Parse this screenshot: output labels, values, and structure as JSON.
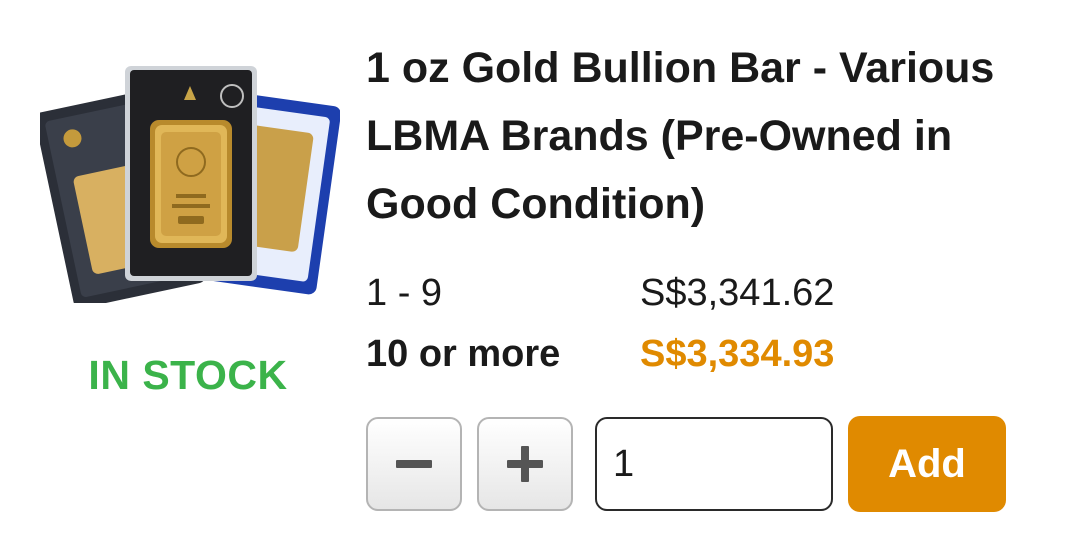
{
  "colors": {
    "accent": "#e08a00",
    "in_stock": "#3bb34a",
    "text": "#1a1a1a"
  },
  "product": {
    "image_icon": "gold-bar-cards-image",
    "stock_label": "IN STOCK",
    "title": "1 oz Gold Bullion Bar - Various LBMA Brands (Pre-Owned in Good Condition)"
  },
  "pricing": [
    {
      "qty": "1 - 9",
      "price": "S$3,341.62"
    },
    {
      "qty": "10 or more",
      "price": "S$3,334.93"
    }
  ],
  "cart": {
    "minus_icon": "minus-icon",
    "plus_icon": "plus-icon",
    "quantity": "1",
    "add_label": "Add"
  }
}
